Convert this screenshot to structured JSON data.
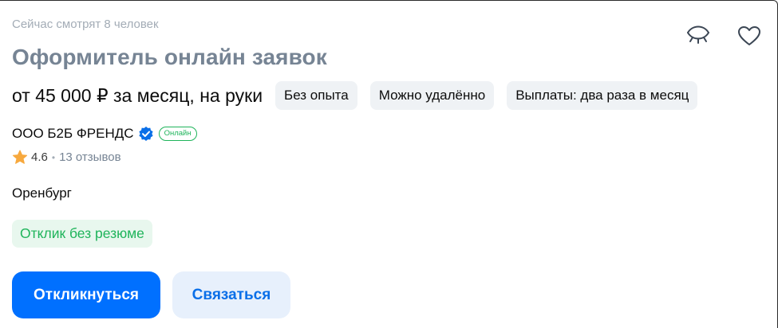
{
  "vacancy": {
    "viewers_text": "Сейчас смотрят 8 человек",
    "title": "Оформитель онлайн заявок",
    "salary": "от 45 000 ₽ за месяц, на руки",
    "tags": [
      "Без опыта",
      "Можно удалённо",
      "Выплаты: два раза в месяц"
    ],
    "company": "ООО Б2Б ФРЕНДС",
    "online_badge": "Онлайн",
    "rating": "4.6",
    "separator": "•",
    "reviews": "13 отзывов",
    "city": "Оренбург",
    "no_resume_label": "Отклик без резюме"
  },
  "actions": {
    "respond_label": "Откликнуться",
    "contact_label": "Связаться"
  },
  "icons": {
    "hide": "eye-closed-icon",
    "favorite": "heart-icon",
    "verified": "verified-check-icon",
    "rating": "star-icon"
  },
  "colors": {
    "title": "#768494",
    "primary": "#0070ff",
    "secondary_bg": "#e7f0fc",
    "green": "#1fb45b",
    "tag_bg": "#eff2f5",
    "star": "#f7a93e"
  }
}
